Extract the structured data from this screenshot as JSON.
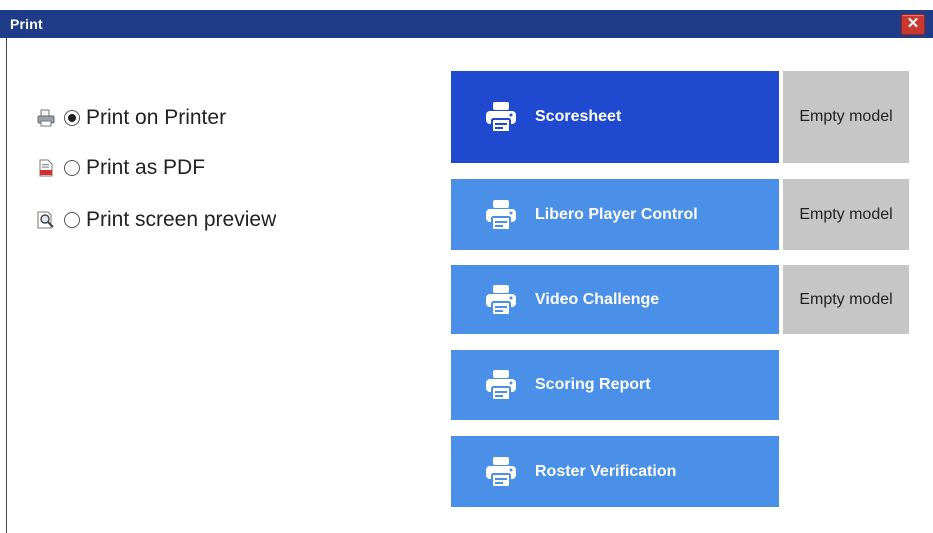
{
  "window": {
    "title": "Print",
    "close_label": "✕"
  },
  "options": [
    {
      "icon": "printer-icon",
      "label": "Print on Printer",
      "selected": true
    },
    {
      "icon": "pdf-icon",
      "label": "Print as PDF",
      "selected": false
    },
    {
      "icon": "screen-preview-icon",
      "label": "Print screen preview",
      "selected": false
    }
  ],
  "reports": [
    {
      "label": "Scoresheet",
      "model": "Empty model",
      "active": true
    },
    {
      "label": "Libero Player Control",
      "model": "Empty model",
      "active": false
    },
    {
      "label": "Video Challenge",
      "model": "Empty model",
      "active": false
    },
    {
      "label": "Scoring Report",
      "active": false
    },
    {
      "label": "Roster Verification",
      "active": false
    }
  ],
  "colors": {
    "titlebar": "#1f3c88",
    "active_button": "#1f49cf",
    "button": "#4a8fe8",
    "model_box": "#c6c6c6",
    "close": "#c9382f"
  }
}
